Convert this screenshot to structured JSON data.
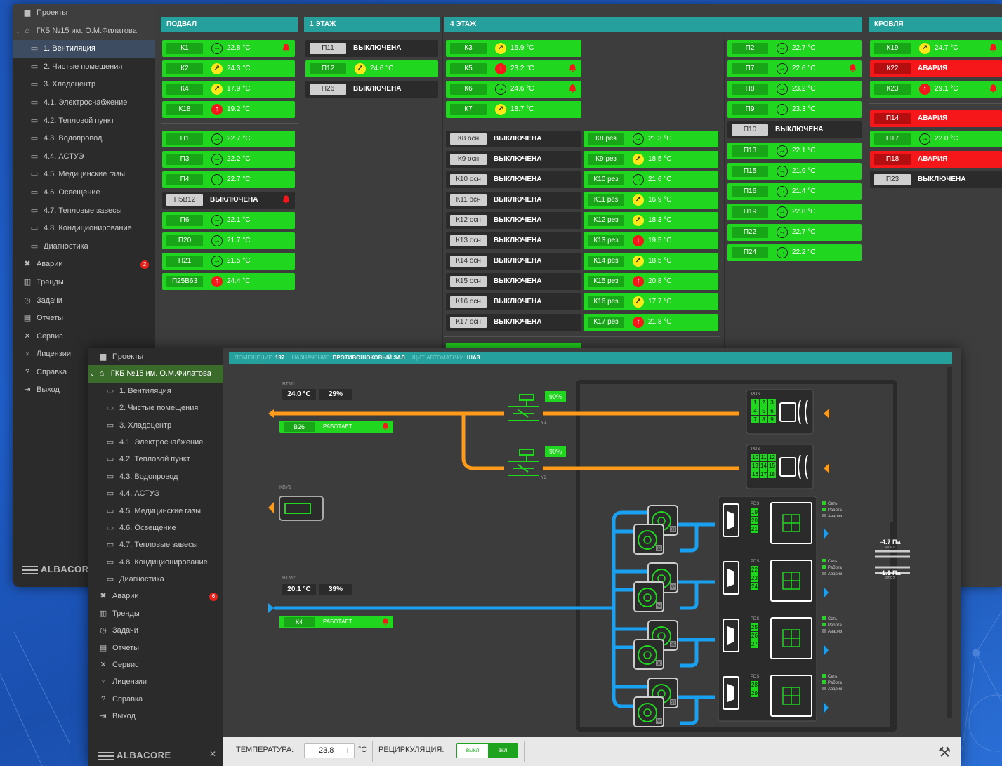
{
  "sidebar": {
    "projects": "Проекты",
    "project_name": "ГКБ №15 им. О.М.Филатова",
    "items": [
      "1. Вентиляция",
      "2. Чистые помещения",
      "3. Хладоцентр",
      "4.1. Электроснабжение",
      "4.2. Тепловой пункт",
      "4.3. Водопровод",
      "4.4. АСТУЭ",
      "4.5. Медицинские газы",
      "4.6. Освещение",
      "4.7. Тепловые завесы",
      "4.8. Кондиционирование",
      "Диагностика"
    ],
    "alarms": "Аварии",
    "alarms_count_back": "2",
    "alarms_count_front": "6",
    "trends": "Тренды",
    "tasks": "Задачи",
    "reports": "Отчеты",
    "service": "Сервис",
    "licenses": "Лицензии",
    "help": "Справка",
    "exit": "Выход",
    "logo": "ALBACORE"
  },
  "columns": {
    "basement": "ПОДВАЛ",
    "floor1": "1 ЭТАЖ",
    "floor4": "4 ЭТАЖ",
    "roof": "КРОВЛЯ"
  },
  "status_words": {
    "off": "ВЫКЛЮЧЕНА",
    "alarm": "АВАРИЯ",
    "running": "РАБОТАЕТ"
  },
  "tiles": {
    "basement": [
      {
        "name": "К1",
        "state": "on",
        "trend": "same",
        "temp": "22.8 °C",
        "bell": true
      },
      {
        "name": "К2",
        "state": "on",
        "trend": "up",
        "temp": "24.3 °C"
      },
      {
        "name": "К4",
        "state": "on",
        "trend": "up",
        "temp": "17.9 °C"
      },
      {
        "name": "К18",
        "state": "on",
        "trend": "hot",
        "temp": "19.2 °C"
      },
      {
        "name": "П1",
        "state": "on",
        "trend": "same",
        "temp": "22.7 °C"
      },
      {
        "name": "П3",
        "state": "on",
        "trend": "same",
        "temp": "22.2 °C"
      },
      {
        "name": "П4",
        "state": "on",
        "trend": "same",
        "temp": "22.7 °C"
      },
      {
        "name": "П5В12",
        "state": "off",
        "bell": true
      },
      {
        "name": "П6",
        "state": "on",
        "trend": "same",
        "temp": "22.1 °C"
      },
      {
        "name": "П20",
        "state": "on",
        "trend": "same",
        "temp": "21.7 °C"
      },
      {
        "name": "П21",
        "state": "on",
        "trend": "same",
        "temp": "21.5 °C"
      },
      {
        "name": "П25В63",
        "state": "on",
        "trend": "hot",
        "temp": "24.4 °C"
      }
    ],
    "floor1": [
      {
        "name": "П11",
        "state": "off"
      },
      {
        "name": "П12",
        "state": "on",
        "trend": "up",
        "temp": "24.6 °C"
      },
      {
        "name": "П26",
        "state": "off"
      }
    ],
    "floor4_top": [
      {
        "name": "К3",
        "state": "on",
        "trend": "up",
        "temp": "16.9 °C"
      },
      {
        "name": "К5",
        "state": "on",
        "trend": "hot",
        "temp": "23.2 °C",
        "bell": true
      },
      {
        "name": "К6",
        "state": "on",
        "trend": "same",
        "temp": "24.6 °C",
        "bell": true
      },
      {
        "name": "К7",
        "state": "on",
        "trend": "up",
        "temp": "18.7 °C"
      }
    ],
    "floor4_main": [
      {
        "name": "К8 осн",
        "state": "off"
      },
      {
        "name": "К9 осн",
        "state": "off"
      },
      {
        "name": "К10 осн",
        "state": "off"
      },
      {
        "name": "К11 осн",
        "state": "off"
      },
      {
        "name": "К12 осн",
        "state": "off"
      },
      {
        "name": "К13 осн",
        "state": "off"
      },
      {
        "name": "К14 осн",
        "state": "off"
      },
      {
        "name": "К15 осн",
        "state": "off"
      },
      {
        "name": "К16 осн",
        "state": "off"
      },
      {
        "name": "К17 осн",
        "state": "off"
      }
    ],
    "floor4_reserve": [
      {
        "name": "К8 рез",
        "state": "on",
        "trend": "same",
        "temp": "21.3 °C"
      },
      {
        "name": "К9 рез",
        "state": "on",
        "trend": "up",
        "temp": "18.5 °C"
      },
      {
        "name": "К10 рез",
        "state": "on",
        "trend": "same",
        "temp": "21.6 °C"
      },
      {
        "name": "К11 рез",
        "state": "on",
        "trend": "up",
        "temp": "16.9 °C"
      },
      {
        "name": "К12 рез",
        "state": "on",
        "trend": "up",
        "temp": "18.3 °C"
      },
      {
        "name": "К13 рез",
        "state": "on",
        "trend": "hot",
        "temp": "19.5 °C"
      },
      {
        "name": "К14 рез",
        "state": "on",
        "trend": "up",
        "temp": "18.5 °C"
      },
      {
        "name": "К15 рез",
        "state": "on",
        "trend": "hot",
        "temp": "20.8 °C"
      },
      {
        "name": "К16 рез",
        "state": "on",
        "trend": "up",
        "temp": "17.7 °C"
      },
      {
        "name": "К17 рез",
        "state": "on",
        "trend": "hot",
        "temp": "21.8 °C"
      }
    ],
    "floor4_right": [
      {
        "name": "П2",
        "state": "on",
        "trend": "same",
        "temp": "22.7 °C"
      },
      {
        "name": "П7",
        "state": "on",
        "trend": "same",
        "temp": "22.6 °C",
        "bell": true
      },
      {
        "name": "П8",
        "state": "on",
        "trend": "same",
        "temp": "23.2 °C"
      },
      {
        "name": "П9",
        "state": "on",
        "trend": "same",
        "temp": "23.3 °C"
      },
      {
        "name": "П10",
        "state": "off"
      },
      {
        "name": "П13",
        "state": "on",
        "trend": "same",
        "temp": "22.1 °C"
      },
      {
        "name": "П15",
        "state": "on",
        "trend": "same",
        "temp": "21.9 °C"
      },
      {
        "name": "П16",
        "state": "on",
        "trend": "same",
        "temp": "21.4 °C"
      },
      {
        "name": "П19",
        "state": "on",
        "trend": "same",
        "temp": "22.8 °C"
      },
      {
        "name": "П22",
        "state": "on",
        "trend": "same",
        "temp": "22.7 °C"
      },
      {
        "name": "П24",
        "state": "on",
        "trend": "same",
        "temp": "22.2 °C"
      }
    ],
    "roof": [
      {
        "name": "К19",
        "state": "on",
        "trend": "up",
        "temp": "24.7 °C",
        "bell": true
      },
      {
        "name": "К22",
        "state": "alarm"
      },
      {
        "name": "К23",
        "state": "on",
        "trend": "hot",
        "temp": "29.1 °C",
        "bell": true
      },
      {
        "name": "П14",
        "state": "alarm"
      },
      {
        "name": "П17",
        "state": "on",
        "trend": "same",
        "temp": "22.0 °C"
      },
      {
        "name": "П18",
        "state": "alarm"
      },
      {
        "name": "П23",
        "state": "off"
      }
    ]
  },
  "detail": {
    "room_label": "ПОМЕЩЕНИЕ:",
    "room_value": "137",
    "purpose_label": "НАЗНАЧЕНИЕ:",
    "purpose_value": "ПРОТИВОШОКОВЫЙ ЗАЛ",
    "panel_label": "ЩИТ АВТОМАТИКИ:",
    "panel_value": "ШАЗ",
    "btm1_label": "BTM1",
    "btm1_temp": "24.0 °C",
    "btm1_hum": "29%",
    "btm2_label": "BTM2",
    "btm2_temp": "20.1 °C",
    "btm2_hum": "39%",
    "unit_b26": "В26",
    "unit_k4": "К4",
    "kvu_label": "КВУ1",
    "valve_y1": "Y1",
    "valve_y2": "Y2",
    "valve1_pct": "90%",
    "valve2_pct": "90%",
    "pds_label": "PDS",
    "pds1_cells": [
      "1",
      "2",
      "3",
      "4",
      "5",
      "6",
      "7",
      "8",
      "9"
    ],
    "pds2_cells": [
      "10",
      "11",
      "12",
      "13",
      "14",
      "15",
      "16",
      "17",
      "18"
    ],
    "pds_cols": [
      [
        "19",
        "20",
        "21"
      ],
      [
        "22",
        "23",
        "24"
      ],
      [
        "25",
        "26",
        "27"
      ],
      [
        "28",
        "29"
      ]
    ],
    "fan_ids": [
      "31",
      "32",
      "33",
      "34",
      "35",
      "36",
      "37",
      "38"
    ],
    "legend": [
      "Сеть",
      "Работа",
      "Авария"
    ],
    "pressure1": "-4.7 Па",
    "pressure1_sub": "PDE1",
    "pressure2": "-1.1 Па",
    "pressure2_sub": "PDE2",
    "temp_label": "ТЕМПЕРАТУРА:",
    "temp_value": "23.8",
    "temp_unit": "°C",
    "recirc_label": "РЕЦИРКУЛЯЦИЯ:",
    "recirc_off": "выкл",
    "recirc_on": "вкл"
  }
}
